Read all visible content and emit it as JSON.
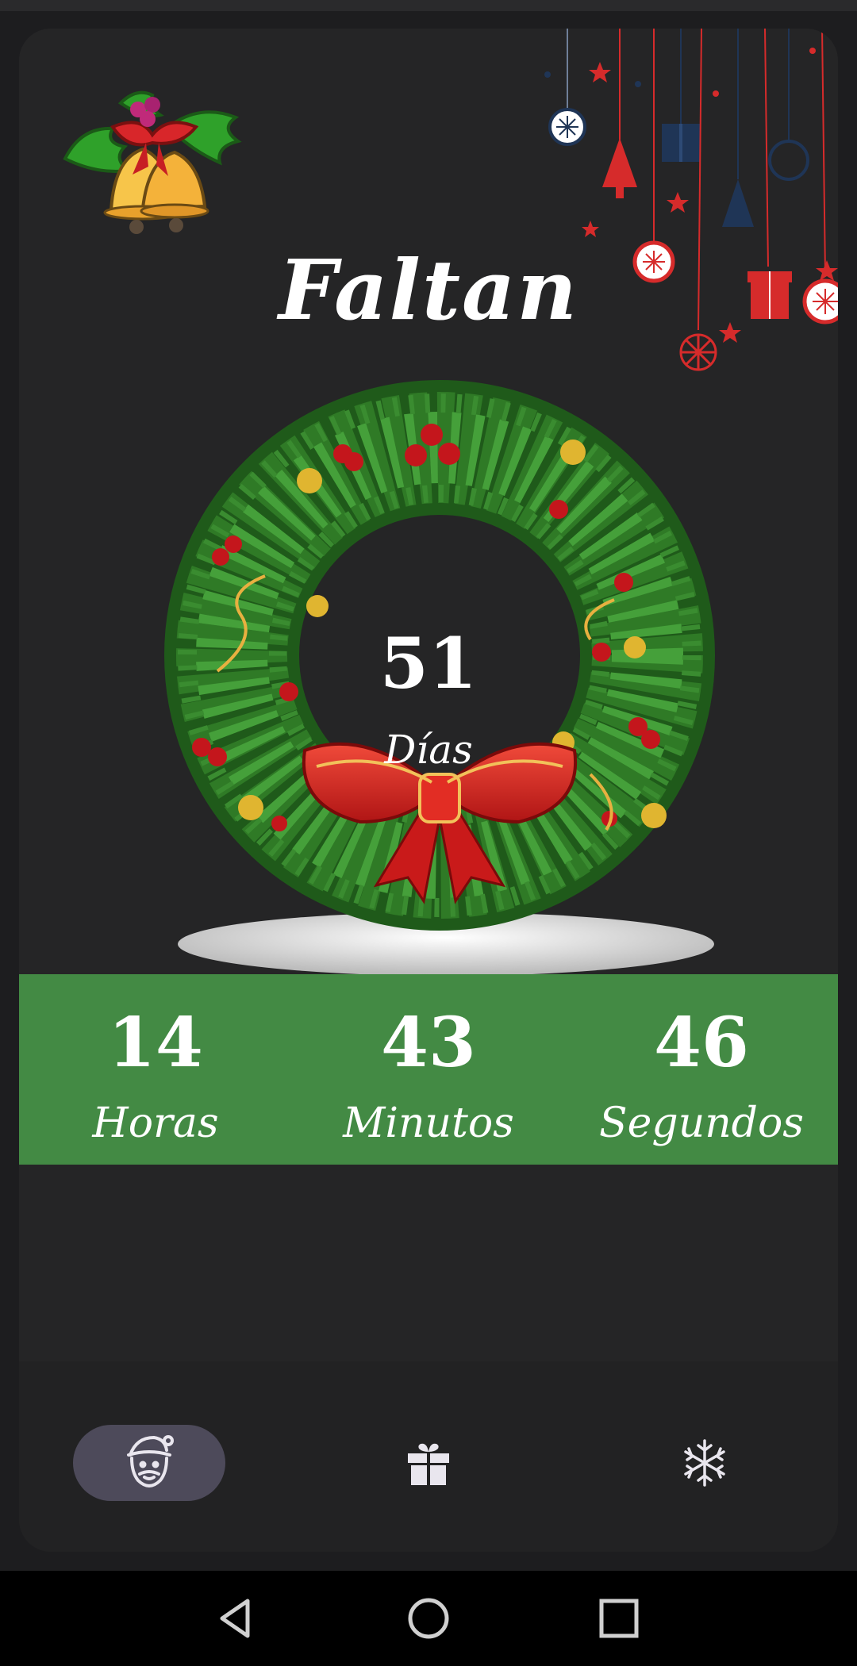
{
  "header": {
    "title": "Faltan"
  },
  "countdown": {
    "days": {
      "value": "51",
      "label": "Días"
    },
    "hours": {
      "value": "14",
      "label": "Horas"
    },
    "minutes": {
      "value": "43",
      "label": "Minutos"
    },
    "seconds": {
      "value": "46",
      "label": "Segundos"
    }
  },
  "bottom_nav": {
    "items": [
      {
        "icon": "santa-icon",
        "selected": true
      },
      {
        "icon": "gift-icon",
        "selected": false
      },
      {
        "icon": "snowflake-icon",
        "selected": false
      }
    ]
  },
  "system_nav": {
    "icons": [
      "back-icon",
      "home-icon",
      "recents-icon"
    ]
  },
  "colors": {
    "background": "#252526",
    "band_green": "#438a44",
    "nav_selected": "#4d4a5a",
    "ornament_red": "#d62b2b",
    "ornament_blue": "#1f3556",
    "wreath_green": "#3c8a2e"
  }
}
